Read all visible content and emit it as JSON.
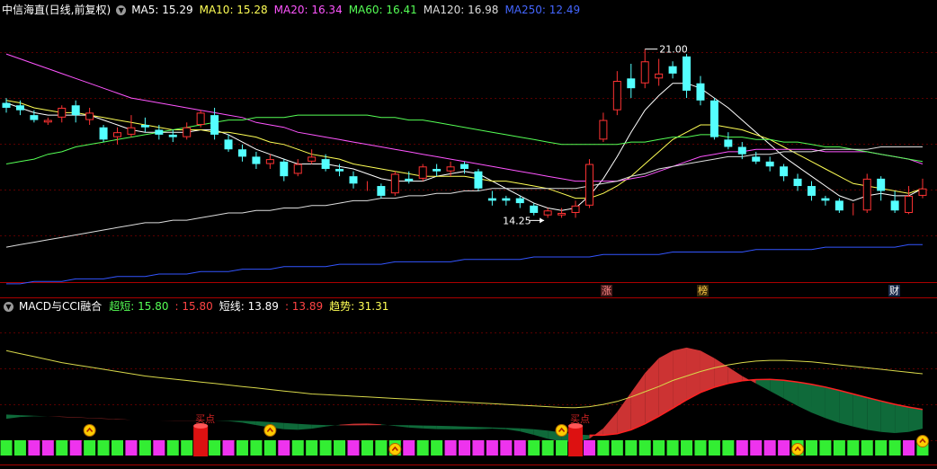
{
  "price_panel": {
    "title": "中信海直(日线,前复权)",
    "dropdown_icon": "chevron-down-icon",
    "ma_legend": [
      {
        "label": "MA5: 15.29",
        "color": "#ffffff"
      },
      {
        "label": "MA10: 15.28",
        "color": "#ffff55"
      },
      {
        "label": "MA20: 16.34",
        "color": "#ff55ff"
      },
      {
        "label": "MA60: 16.41",
        "color": "#55ff55"
      },
      {
        "label": "MA120: 16.98",
        "color": "#dddddd"
      },
      {
        "label": "MA250: 12.49",
        "color": "#4466ff"
      }
    ],
    "high_label": "21.00",
    "low_label": "14.25",
    "markers": [
      {
        "text": "涨",
        "color": "#ff8888"
      },
      {
        "text": "榜",
        "color": "#ffcc44"
      },
      {
        "text": "财",
        "color": "#ffffff"
      }
    ]
  },
  "indicator_panel": {
    "title": "MACD与CCI融合",
    "dropdown_icon": "chevron-down-icon",
    "values": [
      {
        "label": "超短: 15.80",
        "color": "#55ff55"
      },
      {
        "label": ": 15.80",
        "color": "#ff4444"
      },
      {
        "label": "短线: 13.89",
        "color": "#ffffff"
      },
      {
        "label": ": 13.89",
        "color": "#ff4444"
      },
      {
        "label": "趋势: 31.31",
        "color": "#ffff55"
      }
    ],
    "signal_labels": [
      "买点",
      "买点"
    ]
  },
  "chart_data": [
    {
      "type": "candlestick",
      "title": "中信海直(日线,前复权)",
      "ylim": [
        11.8,
        22.2
      ],
      "candles": [
        {
          "o": 18.8,
          "c": 18.6,
          "h": 19.0,
          "l": 18.4
        },
        {
          "o": 18.7,
          "c": 18.5,
          "h": 18.9,
          "l": 18.3
        },
        {
          "o": 18.3,
          "c": 18.1,
          "h": 18.5,
          "l": 18.0
        },
        {
          "o": 18.0,
          "c": 18.1,
          "h": 18.2,
          "l": 17.9
        },
        {
          "o": 18.2,
          "c": 18.6,
          "h": 18.7,
          "l": 18.0
        },
        {
          "o": 18.7,
          "c": 18.3,
          "h": 18.9,
          "l": 18.0
        },
        {
          "o": 18.1,
          "c": 18.4,
          "h": 18.6,
          "l": 17.9
        },
        {
          "o": 17.8,
          "c": 17.3,
          "h": 17.9,
          "l": 17.2
        },
        {
          "o": 17.4,
          "c": 17.6,
          "h": 17.8,
          "l": 17.1
        },
        {
          "o": 17.5,
          "c": 17.8,
          "h": 18.3,
          "l": 17.4
        },
        {
          "o": 17.9,
          "c": 17.8,
          "h": 18.2,
          "l": 17.6
        },
        {
          "o": 17.7,
          "c": 17.5,
          "h": 17.9,
          "l": 17.3
        },
        {
          "o": 17.5,
          "c": 17.4,
          "h": 17.7,
          "l": 17.2
        },
        {
          "o": 17.4,
          "c": 17.8,
          "h": 18.0,
          "l": 17.3
        },
        {
          "o": 17.9,
          "c": 18.4,
          "h": 18.5,
          "l": 17.8
        },
        {
          "o": 18.3,
          "c": 17.5,
          "h": 18.6,
          "l": 17.3
        },
        {
          "o": 17.3,
          "c": 16.9,
          "h": 17.5,
          "l": 16.8
        },
        {
          "o": 16.9,
          "c": 16.6,
          "h": 17.1,
          "l": 16.4
        },
        {
          "o": 16.6,
          "c": 16.3,
          "h": 16.8,
          "l": 16.1
        },
        {
          "o": 16.3,
          "c": 16.5,
          "h": 16.7,
          "l": 16.1
        },
        {
          "o": 16.4,
          "c": 15.8,
          "h": 16.5,
          "l": 15.6
        },
        {
          "o": 15.9,
          "c": 16.3,
          "h": 16.5,
          "l": 15.8
        },
        {
          "o": 16.4,
          "c": 16.6,
          "h": 16.9,
          "l": 16.3
        },
        {
          "o": 16.5,
          "c": 16.1,
          "h": 16.7,
          "l": 16.0
        },
        {
          "o": 16.1,
          "c": 16.0,
          "h": 16.3,
          "l": 15.8
        },
        {
          "o": 15.8,
          "c": 15.5,
          "h": 16.0,
          "l": 15.3
        },
        {
          "o": 15.4,
          "c": 15.4,
          "h": 15.6,
          "l": 15.2
        },
        {
          "o": 15.4,
          "c": 15.0,
          "h": 15.5,
          "l": 14.9
        },
        {
          "o": 15.1,
          "c": 15.9,
          "h": 16.0,
          "l": 15.0
        },
        {
          "o": 15.7,
          "c": 15.6,
          "h": 16.0,
          "l": 15.5
        },
        {
          "o": 15.7,
          "c": 16.2,
          "h": 16.3,
          "l": 15.6
        },
        {
          "o": 16.1,
          "c": 16.0,
          "h": 16.3,
          "l": 15.8
        },
        {
          "o": 16.0,
          "c": 16.2,
          "h": 16.4,
          "l": 15.8
        },
        {
          "o": 16.3,
          "c": 16.1,
          "h": 16.4,
          "l": 15.9
        },
        {
          "o": 16.0,
          "c": 15.3,
          "h": 16.1,
          "l": 15.2
        },
        {
          "o": 14.9,
          "c": 14.8,
          "h": 15.2,
          "l": 14.6
        },
        {
          "o": 14.9,
          "c": 14.8,
          "h": 15.0,
          "l": 14.6
        },
        {
          "o": 14.9,
          "c": 14.7,
          "h": 15.0,
          "l": 14.5
        },
        {
          "o": 14.6,
          "c": 14.3,
          "h": 14.7,
          "l": 14.2
        },
        {
          "o": 14.2,
          "c": 14.4,
          "h": 14.5,
          "l": 14.1
        },
        {
          "o": 14.2,
          "c": 14.3,
          "h": 14.5,
          "l": 14.1
        },
        {
          "o": 14.3,
          "c": 14.6,
          "h": 14.8,
          "l": 14.1
        },
        {
          "o": 14.6,
          "c": 16.3,
          "h": 16.5,
          "l": 14.5
        },
        {
          "o": 17.3,
          "c": 18.1,
          "h": 18.4,
          "l": 17.2
        },
        {
          "o": 18.5,
          "c": 19.7,
          "h": 20.1,
          "l": 18.3
        },
        {
          "o": 19.8,
          "c": 19.4,
          "h": 20.4,
          "l": 19.0
        },
        {
          "o": 19.6,
          "c": 20.5,
          "h": 21.0,
          "l": 19.4
        },
        {
          "o": 19.8,
          "c": 20.0,
          "h": 20.6,
          "l": 19.5
        },
        {
          "o": 20.3,
          "c": 20.0,
          "h": 20.5,
          "l": 19.8
        },
        {
          "o": 20.7,
          "c": 19.3,
          "h": 20.8,
          "l": 19.0
        },
        {
          "o": 19.6,
          "c": 18.9,
          "h": 19.9,
          "l": 18.7
        },
        {
          "o": 18.9,
          "c": 17.4,
          "h": 19.0,
          "l": 17.3
        },
        {
          "o": 17.3,
          "c": 17.0,
          "h": 17.6,
          "l": 16.9
        },
        {
          "o": 17.0,
          "c": 16.7,
          "h": 17.2,
          "l": 16.5
        },
        {
          "o": 16.6,
          "c": 16.4,
          "h": 16.8,
          "l": 16.3
        },
        {
          "o": 16.4,
          "c": 16.2,
          "h": 16.6,
          "l": 16.0
        },
        {
          "o": 16.2,
          "c": 15.8,
          "h": 16.3,
          "l": 15.6
        },
        {
          "o": 15.7,
          "c": 15.4,
          "h": 15.9,
          "l": 15.2
        },
        {
          "o": 15.4,
          "c": 15.0,
          "h": 15.6,
          "l": 14.8
        },
        {
          "o": 14.9,
          "c": 14.8,
          "h": 15.0,
          "l": 14.6
        },
        {
          "o": 14.8,
          "c": 14.4,
          "h": 14.9,
          "l": 14.3
        },
        {
          "o": 14.4,
          "c": 14.4,
          "h": 14.7,
          "l": 14.2
        },
        {
          "o": 14.4,
          "c": 15.7,
          "h": 15.9,
          "l": 14.3
        },
        {
          "o": 15.7,
          "c": 15.2,
          "h": 15.8,
          "l": 14.8
        },
        {
          "o": 14.8,
          "c": 14.4,
          "h": 15.2,
          "l": 14.3
        },
        {
          "o": 14.3,
          "c": 15.0,
          "h": 15.4,
          "l": 14.25
        },
        {
          "o": 15.0,
          "c": 15.3,
          "h": 15.7,
          "l": 14.9
        }
      ],
      "ma": {
        "MA5": [
          18.8,
          18.6,
          18.4,
          18.3,
          18.3,
          18.3,
          18.3,
          18.1,
          17.9,
          17.7,
          17.6,
          17.6,
          17.6,
          17.6,
          17.7,
          17.7,
          17.5,
          17.2,
          16.9,
          16.7,
          16.5,
          16.3,
          16.3,
          16.3,
          16.2,
          16.1,
          15.9,
          15.7,
          15.6,
          15.6,
          15.6,
          15.8,
          15.9,
          16.0,
          15.9,
          15.6,
          15.3,
          15.0,
          14.7,
          14.5,
          14.4,
          14.5,
          15.0,
          15.7,
          16.6,
          17.6,
          18.5,
          19.1,
          19.6,
          19.6,
          19.4,
          19.0,
          18.6,
          18.1,
          17.6,
          17.1,
          16.6,
          16.2,
          15.8,
          15.4,
          15.0,
          14.8,
          15.0,
          15.1,
          15.0,
          15.0,
          15.3
        ],
        "MA10": [
          18.9,
          18.8,
          18.6,
          18.5,
          18.4,
          18.4,
          18.3,
          18.2,
          18.1,
          18.0,
          17.9,
          17.8,
          17.7,
          17.7,
          17.7,
          17.6,
          17.6,
          17.5,
          17.4,
          17.2,
          17.1,
          16.9,
          16.7,
          16.6,
          16.5,
          16.3,
          16.2,
          16.1,
          16.0,
          15.9,
          15.8,
          15.8,
          15.8,
          15.8,
          15.7,
          15.6,
          15.6,
          15.5,
          15.4,
          15.3,
          15.1,
          14.9,
          14.9,
          15.1,
          15.4,
          15.8,
          16.3,
          16.8,
          17.3,
          17.6,
          17.9,
          17.9,
          17.8,
          17.7,
          17.5,
          17.3,
          17.0,
          16.7,
          16.4,
          16.1,
          15.8,
          15.5,
          15.4,
          15.3,
          15.2,
          15.1,
          15.3
        ],
        "MA20": [
          20.8,
          20.6,
          20.4,
          20.2,
          20.0,
          19.8,
          19.6,
          19.4,
          19.2,
          19.0,
          18.9,
          18.8,
          18.7,
          18.6,
          18.5,
          18.4,
          18.3,
          18.2,
          18.0,
          17.9,
          17.8,
          17.6,
          17.5,
          17.4,
          17.3,
          17.2,
          17.1,
          17.0,
          16.9,
          16.8,
          16.7,
          16.6,
          16.5,
          16.4,
          16.3,
          16.2,
          16.1,
          16.0,
          15.9,
          15.8,
          15.7,
          15.6,
          15.6,
          15.6,
          15.6,
          15.7,
          15.8,
          16.0,
          16.2,
          16.4,
          16.6,
          16.7,
          16.8,
          16.8,
          16.9,
          16.9,
          16.9,
          16.9,
          16.9,
          16.8,
          16.8,
          16.8,
          16.8,
          16.7,
          16.6,
          16.5,
          16.3
        ],
        "MA60": [
          16.3,
          16.4,
          16.5,
          16.7,
          16.8,
          17.0,
          17.1,
          17.2,
          17.3,
          17.4,
          17.5,
          17.6,
          17.7,
          17.8,
          17.9,
          18.0,
          18.1,
          18.1,
          18.2,
          18.2,
          18.2,
          18.3,
          18.3,
          18.3,
          18.3,
          18.3,
          18.3,
          18.2,
          18.2,
          18.1,
          18.1,
          18.0,
          17.9,
          17.8,
          17.7,
          17.6,
          17.5,
          17.4,
          17.3,
          17.2,
          17.1,
          17.1,
          17.1,
          17.1,
          17.1,
          17.2,
          17.2,
          17.3,
          17.4,
          17.4,
          17.5,
          17.5,
          17.4,
          17.4,
          17.3,
          17.3,
          17.2,
          17.2,
          17.1,
          17.0,
          17.0,
          16.9,
          16.8,
          16.7,
          16.6,
          16.5,
          16.4
        ],
        "MA120": [
          12.9,
          13.0,
          13.1,
          13.2,
          13.3,
          13.4,
          13.5,
          13.6,
          13.7,
          13.8,
          13.9,
          13.9,
          14.0,
          14.0,
          14.1,
          14.2,
          14.3,
          14.3,
          14.4,
          14.4,
          14.5,
          14.5,
          14.6,
          14.6,
          14.7,
          14.8,
          14.8,
          14.9,
          14.9,
          15.0,
          15.0,
          15.1,
          15.1,
          15.2,
          15.2,
          15.3,
          15.3,
          15.3,
          15.3,
          15.3,
          15.3,
          15.3,
          15.4,
          15.5,
          15.6,
          15.8,
          15.9,
          16.1,
          16.2,
          16.3,
          16.4,
          16.5,
          16.6,
          16.6,
          16.7,
          16.7,
          16.8,
          16.8,
          16.8,
          16.9,
          16.9,
          16.9,
          16.9,
          17.0,
          17.0,
          17.0,
          17.0
        ],
        "MA250": [
          11.4,
          11.4,
          11.5,
          11.5,
          11.5,
          11.6,
          11.6,
          11.6,
          11.7,
          11.7,
          11.7,
          11.8,
          11.8,
          11.8,
          11.9,
          11.9,
          11.9,
          12.0,
          12.0,
          12.0,
          12.1,
          12.1,
          12.1,
          12.1,
          12.2,
          12.2,
          12.2,
          12.2,
          12.3,
          12.3,
          12.3,
          12.3,
          12.3,
          12.4,
          12.4,
          12.4,
          12.4,
          12.4,
          12.5,
          12.5,
          12.5,
          12.5,
          12.5,
          12.6,
          12.6,
          12.6,
          12.6,
          12.6,
          12.7,
          12.7,
          12.7,
          12.7,
          12.7,
          12.7,
          12.8,
          12.8,
          12.8,
          12.8,
          12.8,
          12.9,
          12.9,
          12.9,
          12.9,
          12.9,
          12.9,
          13.0,
          13.0
        ]
      }
    },
    {
      "type": "area",
      "title": "MACD与CCI融合",
      "ylim": [
        -25,
        70
      ],
      "fast": [
        1.4,
        2.6,
        3.0,
        3.0,
        2.8,
        2.4,
        2.0,
        1.6,
        1.2,
        0.7,
        0.4,
        0.2,
        0.2,
        0.2,
        0.2,
        0.1,
        -0.2,
        -1.2,
        -2.8,
        -4.4,
        -5.6,
        -6.0,
        -5.2,
        -3.8,
        -2.6,
        -1.9,
        -1.8,
        -2.3,
        -3.4,
        -4.5,
        -5.1,
        -5.5,
        -5.6,
        -5.6,
        -5.5,
        -5.2,
        -5.6,
        -7.0,
        -9.4,
        -12.0,
        -13.8,
        -14.0,
        -12.0,
        -5.0,
        6.0,
        19.0,
        32.0,
        42.0,
        47.0,
        49.0,
        47.0,
        42.0,
        36.0,
        30.0,
        25.0,
        20.0,
        15.0,
        10.0,
        5.5,
        1.8,
        -1.4,
        -3.8,
        -6.0,
        -7.4,
        -8.2,
        -7.4,
        -5.2
      ],
      "slow": [
        4.2,
        3.8,
        3.4,
        3.0,
        2.6,
        2.2,
        1.8,
        1.4,
        1.0,
        0.7,
        0.4,
        0.2,
        0.1,
        0.1,
        0.1,
        0.1,
        0.1,
        0.0,
        -0.3,
        -0.8,
        -1.4,
        -2.0,
        -2.5,
        -2.8,
        -3.0,
        -3.0,
        -2.9,
        -2.8,
        -2.8,
        -2.9,
        -3.1,
        -3.3,
        -3.5,
        -3.8,
        -4.1,
        -4.4,
        -4.7,
        -5.0,
        -5.6,
        -6.5,
        -7.8,
        -9.0,
        -9.6,
        -9.6,
        -8.6,
        -6.0,
        -2.0,
        3.0,
        8.5,
        14.0,
        19.0,
        22.5,
        25.0,
        26.8,
        27.6,
        27.8,
        27.2,
        26.0,
        24.4,
        22.6,
        20.4,
        18.0,
        15.6,
        13.3,
        11.1,
        9.2,
        7.6
      ],
      "trend": [
        47,
        45,
        43,
        41,
        39,
        37.5,
        36,
        34.5,
        33,
        31.5,
        30,
        29,
        28,
        27,
        26,
        25,
        24,
        23,
        22,
        21,
        20,
        19,
        18,
        17.5,
        17,
        16.5,
        16,
        15.5,
        15,
        14.5,
        14,
        13.5,
        13,
        12.5,
        12,
        11.5,
        11,
        10.5,
        10,
        9.5,
        9,
        8.8,
        9.5,
        11,
        13,
        16,
        19.5,
        23,
        27,
        30,
        33,
        35.5,
        37.5,
        39,
        40,
        40.5,
        40.5,
        40,
        39.5,
        38.5,
        37.5,
        36.5,
        35.5,
        34.5,
        33.5,
        32.5,
        31.5
      ],
      "bars": [
        "g",
        "g",
        "m",
        "m",
        "g",
        "m",
        "g",
        "g",
        "g",
        "m",
        "g",
        "m",
        "g",
        "g",
        "m",
        "g",
        "m",
        "g",
        "g",
        "g",
        "m",
        "g",
        "g",
        "g",
        "g",
        "m",
        "g",
        "g",
        "g",
        "m",
        "g",
        "g",
        "m",
        "m",
        "m",
        "m",
        "m",
        "m",
        "g",
        "g",
        "g",
        "g",
        "m",
        "g",
        "g",
        "g",
        "g",
        "g",
        "g",
        "g",
        "g",
        "g",
        "g",
        "m",
        "m",
        "m",
        "m",
        "g",
        "g",
        "g",
        "g",
        "g",
        "g",
        "g",
        "g",
        "m",
        "g"
      ],
      "buy_at": [
        6,
        19,
        28,
        40,
        57,
        66
      ],
      "red_bars": [
        14,
        41
      ]
    }
  ]
}
